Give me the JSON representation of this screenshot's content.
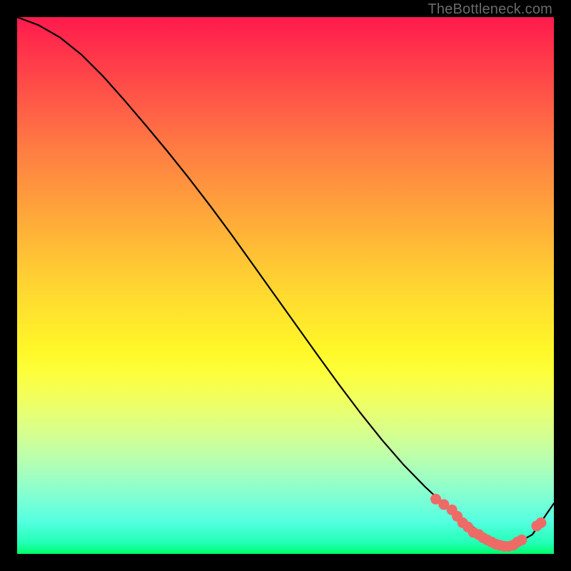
{
  "watermark": "TheBottleneck.com",
  "chart_data": {
    "type": "line",
    "title": "",
    "xlabel": "",
    "ylabel": "",
    "xlim": [
      0,
      100
    ],
    "ylim": [
      0,
      100
    ],
    "curve": {
      "name": "bottleneck-curve",
      "x": [
        0,
        4,
        8,
        12,
        16,
        20,
        24,
        28,
        32,
        36,
        40,
        44,
        48,
        52,
        56,
        60,
        64,
        68,
        72,
        76,
        80,
        84,
        88,
        92,
        96,
        100
      ],
      "y": [
        100,
        98.5,
        96.2,
        93.0,
        89.0,
        84.5,
        79.8,
        75.0,
        70.0,
        64.8,
        59.4,
        53.8,
        48.2,
        42.6,
        37.0,
        31.5,
        26.2,
        21.2,
        16.6,
        12.5,
        8.8,
        5.6,
        3.0,
        1.4,
        3.6,
        9.4
      ]
    },
    "markers": {
      "name": "recommended-range",
      "color": "#ee6a66",
      "points": [
        {
          "x": 78.0,
          "y": 10.2
        },
        {
          "x": 79.5,
          "y": 9.2
        },
        {
          "x": 81.0,
          "y": 8.2
        },
        {
          "x": 82.0,
          "y": 7.0
        },
        {
          "x": 83.0,
          "y": 5.8
        },
        {
          "x": 84.0,
          "y": 5.0
        },
        {
          "x": 85.0,
          "y": 4.0
        },
        {
          "x": 86.0,
          "y": 3.6
        },
        {
          "x": 86.8,
          "y": 3.0
        },
        {
          "x": 87.6,
          "y": 2.6
        },
        {
          "x": 88.4,
          "y": 2.2
        },
        {
          "x": 89.2,
          "y": 1.8
        },
        {
          "x": 90.0,
          "y": 1.6
        },
        {
          "x": 90.8,
          "y": 1.4
        },
        {
          "x": 91.6,
          "y": 1.4
        },
        {
          "x": 92.4,
          "y": 1.6
        },
        {
          "x": 93.2,
          "y": 2.2
        },
        {
          "x": 94.0,
          "y": 2.6
        },
        {
          "x": 96.8,
          "y": 5.2
        },
        {
          "x": 97.6,
          "y": 5.8
        }
      ]
    }
  }
}
